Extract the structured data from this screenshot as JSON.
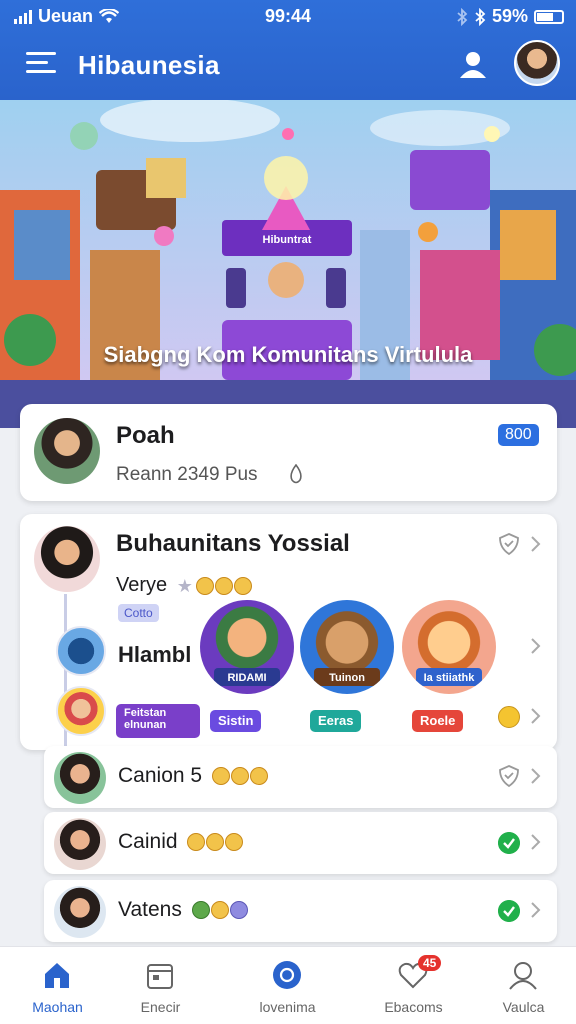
{
  "status_bar": {
    "carrier": "Ueuan",
    "time": "99:44",
    "battery": "59%"
  },
  "app_bar": {
    "title": "Hibaunesia"
  },
  "hero": {
    "caption": "Siabgng Kom Komunitans Virtulula",
    "stage_sign": "Hibuntrat"
  },
  "profile_card": {
    "name": "Poah",
    "stats": "Reann 2349 Pus",
    "badge": "800"
  },
  "community_card": {
    "title": "Buhaunitans Yossial",
    "subtitle": "Verye",
    "tag": "Cotto",
    "sub_label": "Hlambl",
    "tiles": [
      {
        "label": "RIDAMI"
      },
      {
        "label": "Tuinon"
      },
      {
        "label": "Ia stiiathk"
      }
    ],
    "chips": [
      {
        "label": "Feitstan elnunan"
      },
      {
        "label": "Sistin"
      },
      {
        "label": "Eeras"
      },
      {
        "label": "Roele"
      }
    ]
  },
  "list_rows": [
    {
      "label": "Canion 5",
      "status": "shield"
    },
    {
      "label": "Cainid",
      "status": "check"
    },
    {
      "label": "Vatens",
      "status": "check"
    }
  ],
  "bottom_nav": {
    "items": [
      {
        "label": "Maohan",
        "icon": "home-icon",
        "active": true
      },
      {
        "label": "Enecir",
        "icon": "calendar-icon",
        "active": false
      },
      {
        "label": "lovenima",
        "icon": "compass-icon",
        "active": false
      },
      {
        "label": "Ebacoms",
        "icon": "heart-icon",
        "active": false,
        "badge": "45"
      },
      {
        "label": "Vaulca",
        "icon": "profile-icon",
        "active": false
      }
    ]
  },
  "colors": {
    "primary": "#2a63cc",
    "badge": "#2c6fe0",
    "success": "#21b04b",
    "alert": "#e5322d"
  }
}
